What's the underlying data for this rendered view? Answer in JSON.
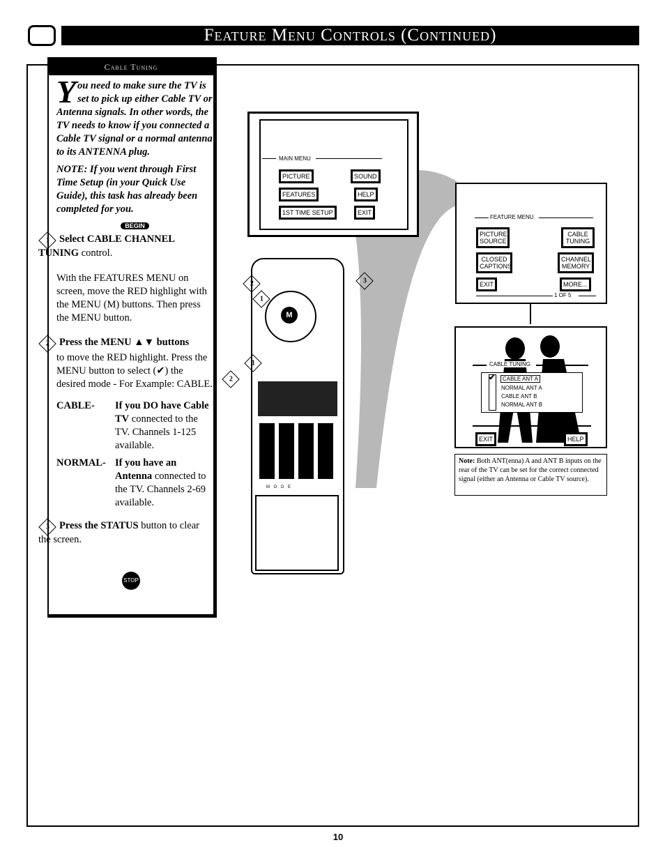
{
  "header": {
    "title": "Feature Menu Controls (Continued)"
  },
  "sidebar": {
    "section_title": "Cable Tuning",
    "intro_dropcap": "Y",
    "intro": "ou need to make sure the TV is set to pick up either Cable TV or Antenna signals. In other words, the TV needs to know if you connected a Cable TV signal or a normal antenna to its ANTENNA plug.",
    "note": "NOTE: If you went through First Time Setup (in your Quick Use Guide), this task has already been completed for you.",
    "begin": "BEGIN",
    "step1_num": "1",
    "step1_title": "Select CABLE CHANNEL TUNING",
    "step1_suffix": " control.",
    "step1_body": "With the FEATURES MENU on screen, move the RED highlight with the MENU (M) buttons. Then press the MENU button.",
    "step2_num": "2",
    "step2_title": "Press the MENU ▲▼ buttons",
    "step2_body": "to move the RED highlight. Press the MENU button to select (✔) the desired mode - For Example: CABLE.",
    "cable_label": "CABLE-",
    "cable_bold": "If you DO have Cable TV",
    "cable_rest": " connected to the TV. Channels 1-125 available.",
    "normal_label": "NORMAL-",
    "normal_bold": "If you have an Antenna",
    "normal_rest": " connected to the TV. Channels 2-69 available.",
    "step3_num": "3",
    "step3_title": "Press the STATUS",
    "step3_suffix": " button to clear the screen.",
    "stop": "STOP"
  },
  "main_menu": {
    "title": "MAIN MENU",
    "items": [
      "PICTURE",
      "SOUND",
      "FEATURES",
      "HELP",
      "1ST TIME SETUP",
      "EXIT"
    ]
  },
  "feature_menu": {
    "title": "FEATURE MENU",
    "items": [
      "PICTURE SOURCE",
      "CABLE TUNING",
      "CLOSED CAPTIONS",
      "CHANNEL MEMORY",
      "EXIT",
      "MORE..."
    ],
    "page": "1 OF 5"
  },
  "cable_tuning_menu": {
    "title": "CABLE TUNING",
    "options": [
      "CABLE ANT A",
      "NORMAL ANT A",
      "CABLE ANT B",
      "NORMAL ANT B"
    ],
    "selected": "CABLE ANT A",
    "buttons": [
      "EXIT",
      "HELP"
    ]
  },
  "note_box": {
    "bold": "Note:",
    "text": " Both ANT(enna) A and ANT B inputs on the rear of the TV can be set for the correct connected signal (either an Antenna or Cable TV source)."
  },
  "remote": {
    "callouts": [
      "2",
      "1",
      "3",
      "1",
      "2"
    ],
    "mode_label": "M O D E"
  },
  "page_number": "10"
}
